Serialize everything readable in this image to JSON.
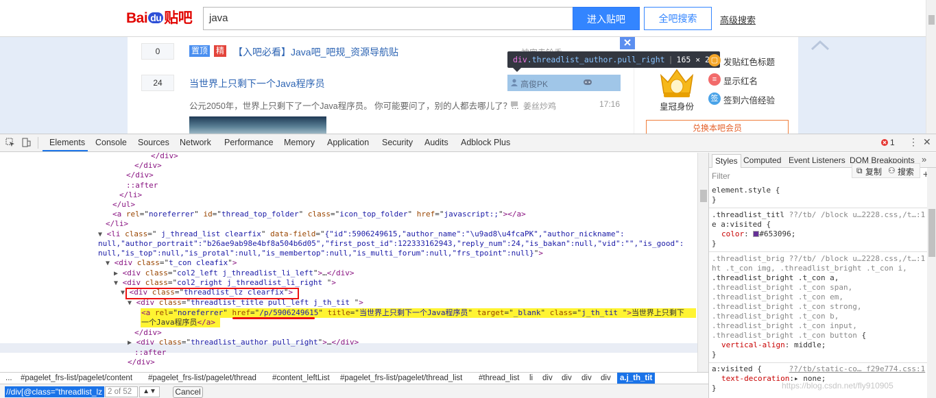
{
  "web": {
    "logo": {
      "bai": "Bai",
      "du": "du",
      "tieba": "贴吧"
    },
    "search_value": "java",
    "enter_button": "进入贴吧",
    "all_search_button": "全吧搜索",
    "advanced_link": "高级搜索",
    "threads": [
      {
        "reply_count": "0",
        "tags": [
          "置顶",
          "精"
        ],
        "title": "【入吧必看】Java吧_吧规_资源导航贴",
        "author": "神宮寺铃香"
      },
      {
        "reply_count": "24",
        "title": "当世界上只剩下一个Java程序员",
        "author": "高俊PK",
        "abstract": "公元2050年，世界上只剩下了一个Java程序员。 你可能要问了，别的人都去哪儿了？...",
        "last_reply_author": "姜丝炒鸡",
        "last_reply_time": "17:16"
      }
    ],
    "tooltip": {
      "tag": "div",
      "classes": ".threadlist_author.pull_right",
      "size": "165 × 24"
    },
    "sidebar": {
      "crown_label": "皇冠身份",
      "perks": [
        "发贴红色标题",
        "显示红名",
        "签到六倍经验"
      ],
      "sign_icon_text": "签",
      "renew_button": "兑换本吧会员"
    }
  },
  "devtools": {
    "tabs": [
      "Elements",
      "Console",
      "Sources",
      "Network",
      "Performance",
      "Memory",
      "Application",
      "Security",
      "Audits",
      "Adblock Plus"
    ],
    "error_count": "1",
    "breadcrumbs": [
      "...",
      "#pagelet_frs-list/pagelet/content",
      "#pagelet_frs-list/pagelet/thread",
      "#content_leftList",
      "#pagelet_frs-list/pagelet/thread_list",
      "#thread_list",
      "li",
      "div",
      "div",
      "div",
      "div",
      "a.j_th_tit"
    ],
    "find": {
      "query": "//div[@class=\"threadlist_lz",
      "count": "2 of 52",
      "cancel": "Cancel"
    },
    "styles_tabs": [
      "Styles",
      "Computed",
      "Event Listeners",
      "DOM Breakpoints"
    ],
    "filter_placeholder": "Filter",
    "copy_label": "复制",
    "search_label": "搜索",
    "watermark": "https://blog.csdn.net/fly910905"
  }
}
